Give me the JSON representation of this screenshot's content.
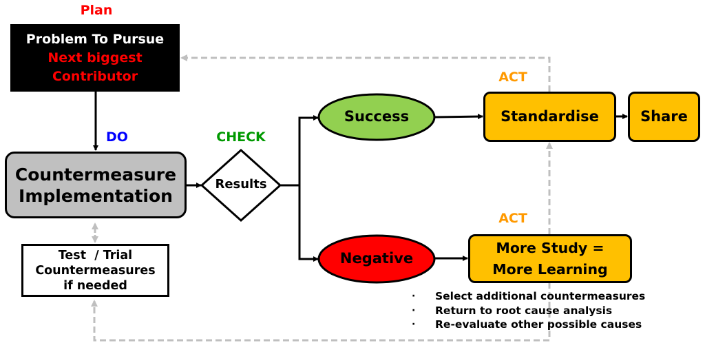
{
  "phases": {
    "plan": {
      "label": "Plan",
      "color": "#ff0000"
    },
    "do": {
      "label": "DO",
      "color": "#0000ff"
    },
    "check": {
      "label": "CHECK",
      "color": "#009900"
    },
    "act_top": {
      "label": "ACT",
      "color": "#ff9900"
    },
    "act_bottom": {
      "label": "ACT",
      "color": "#ff9900"
    }
  },
  "nodes": {
    "problem": {
      "line1": "Problem To Pursue",
      "line2": "Next biggest",
      "line3": "Contributor",
      "bg": "#000000",
      "title_color": "#ffffff",
      "accent_color": "#ff0000"
    },
    "countermeasure": {
      "line1": "Countermeasure",
      "line2": "Implementation",
      "bg": "#c0c0c0"
    },
    "test_trial": {
      "line1": "Test  / Trial",
      "line2": "Countermeasures",
      "line3": "if needed",
      "bg": "#ffffff"
    },
    "results": {
      "label": "Results"
    },
    "success": {
      "label": "Success",
      "bg": "#92d050"
    },
    "negative": {
      "label": "Negative",
      "bg": "#ff0000"
    },
    "standardise": {
      "label": "Standardise",
      "bg": "#ffc000"
    },
    "share": {
      "label": "Share",
      "bg": "#ffc000"
    },
    "more_study": {
      "line1": "More Study =",
      "line2": "More Learning",
      "bg": "#ffc000"
    }
  },
  "bullets": [
    "Select additional countermeasures",
    "Return to root cause analysis",
    "Re-evaluate other possible causes"
  ],
  "bullet_marker": "·",
  "colors": {
    "line": "#000000",
    "dashed": "#bfbfbf"
  }
}
